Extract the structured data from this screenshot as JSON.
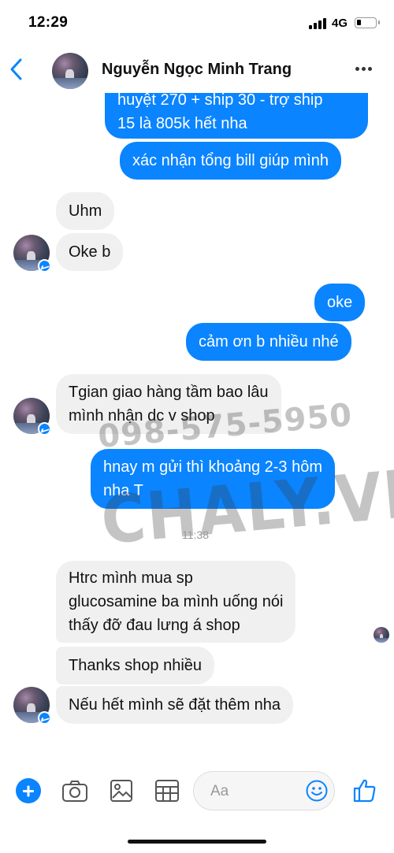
{
  "status_bar": {
    "time": "12:29",
    "network": "4G"
  },
  "header": {
    "contact_name": "Nguyễn Ngọc Minh Trang"
  },
  "messages": [
    {
      "dir": "out",
      "lines": [
        "huyệt 270 + ship 30 - trợ ship",
        "15 là 805k hết nha"
      ]
    },
    {
      "dir": "out",
      "lines": [
        "xác nhận tổng bill giúp mình"
      ]
    },
    {
      "dir": "in",
      "lines": [
        "Uhm"
      ]
    },
    {
      "dir": "in",
      "lines": [
        "Oke b"
      ]
    },
    {
      "dir": "out",
      "lines": [
        "oke"
      ]
    },
    {
      "dir": "out",
      "lines": [
        "cảm ơn b nhiều nhé"
      ]
    },
    {
      "dir": "in",
      "lines": [
        "Tgian giao hàng tầm bao lâu",
        "mình nhận dc v shop"
      ]
    },
    {
      "dir": "out",
      "lines": [
        "hnay m gửi thì khoảng 2-3 hôm",
        "nha T"
      ]
    },
    {
      "dir": "in",
      "lines": [
        "Htrc mình mua sp",
        "glucosamine ba mình uống nói",
        "thấy đỡ đau lưng á shop"
      ]
    },
    {
      "dir": "in",
      "lines": [
        "Thanks shop nhiều"
      ]
    },
    {
      "dir": "in",
      "lines": [
        "Nếu hết mình sẽ đặt thêm nha"
      ]
    }
  ],
  "timestamp": "11:38",
  "watermark": {
    "phone": "098-575-5950",
    "site": "CHALY.VN"
  },
  "composer": {
    "placeholder": "Aa"
  },
  "colors": {
    "accent": "#0a84ff",
    "incoming_bubble": "#f0f0f0"
  },
  "icons": [
    "back-chevron-icon",
    "more-icon",
    "plus-icon",
    "camera-icon",
    "image-icon",
    "sticker-icon",
    "emoji-icon",
    "thumbs-up-icon"
  ]
}
